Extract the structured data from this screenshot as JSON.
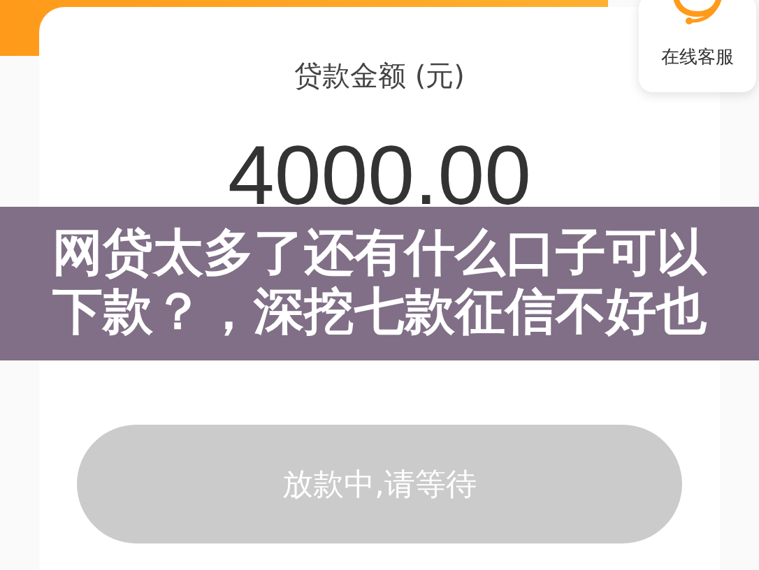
{
  "loan_card": {
    "label": "贷款金额 (元)",
    "amount": "4000.00"
  },
  "service_button": {
    "label": "在线客服"
  },
  "banner": {
    "lines": [
      "网贷太多了还有什么口子可以",
      "下款？，深挖七款征信不好也"
    ]
  },
  "status_button": {
    "label": "放款中,请等待",
    "disabled": true
  }
}
